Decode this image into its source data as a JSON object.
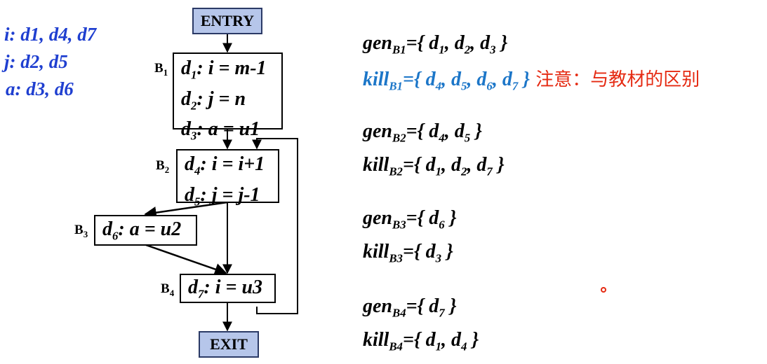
{
  "variables": [
    {
      "name": "i",
      "defs": "d1, d4, d7"
    },
    {
      "name": "j",
      "defs": "d2, d5"
    },
    {
      "name": "a",
      "defs": "d3, d6"
    }
  ],
  "flow": {
    "entry": "ENTRY",
    "exit": "EXIT",
    "blocks": [
      {
        "label": "B",
        "num": "1",
        "stmts": [
          {
            "d": "d",
            "n": "1",
            "code": ": i = m-1"
          },
          {
            "d": "d",
            "n": "2",
            "code": ": j = n"
          },
          {
            "d": "d",
            "n": "3",
            "code": ": a = u1"
          }
        ]
      },
      {
        "label": "B",
        "num": "2",
        "stmts": [
          {
            "d": "d",
            "n": "4",
            "code": ": i = i+1"
          },
          {
            "d": "d",
            "n": "5",
            "code": ": j = j-1"
          }
        ]
      },
      {
        "label": "B",
        "num": "3",
        "stmts": [
          {
            "d": "d",
            "n": "6",
            "code": ": a = u2"
          }
        ]
      },
      {
        "label": "B",
        "num": "4",
        "stmts": [
          {
            "d": "d",
            "n": "7",
            "code": ": i = u3"
          }
        ]
      }
    ]
  },
  "equations": [
    {
      "kind": "gen",
      "block": "B1",
      "defs": [
        {
          "d": "d",
          "n": "1"
        },
        {
          "d": "d",
          "n": "2"
        },
        {
          "d": "d",
          "n": "3"
        }
      ]
    },
    {
      "kind": "kill",
      "block": "B1",
      "defs": [
        {
          "d": "d",
          "n": "4"
        },
        {
          "d": "d",
          "n": "5"
        },
        {
          "d": "d",
          "n": "6"
        },
        {
          "d": "d",
          "n": "7"
        }
      ],
      "note": "注意：与教材的区别"
    },
    {
      "kind": "gen",
      "block": "B2",
      "defs": [
        {
          "d": "d",
          "n": "4"
        },
        {
          "d": "d",
          "n": "5"
        }
      ]
    },
    {
      "kind": "kill",
      "block": "B2",
      "defs": [
        {
          "d": "d",
          "n": "1"
        },
        {
          "d": "d",
          "n": "2"
        },
        {
          "d": "d",
          "n": "7"
        }
      ]
    },
    {
      "kind": "gen",
      "block": "B3",
      "defs": [
        {
          "d": "d",
          "n": "6"
        }
      ]
    },
    {
      "kind": "kill",
      "block": "B3",
      "defs": [
        {
          "d": "d",
          "n": "3"
        }
      ]
    },
    {
      "kind": "gen",
      "block": "B4",
      "defs": [
        {
          "d": "d",
          "n": "7"
        }
      ]
    },
    {
      "kind": "kill",
      "block": "B4",
      "defs": [
        {
          "d": "d",
          "n": "1"
        },
        {
          "d": "d",
          "n": "4"
        }
      ]
    }
  ],
  "colors": {
    "var_list": "#1f3fd0",
    "kill_b1": "#1c76c8",
    "note": "#e52a12",
    "terminal_fill": "#b6c6ea"
  }
}
